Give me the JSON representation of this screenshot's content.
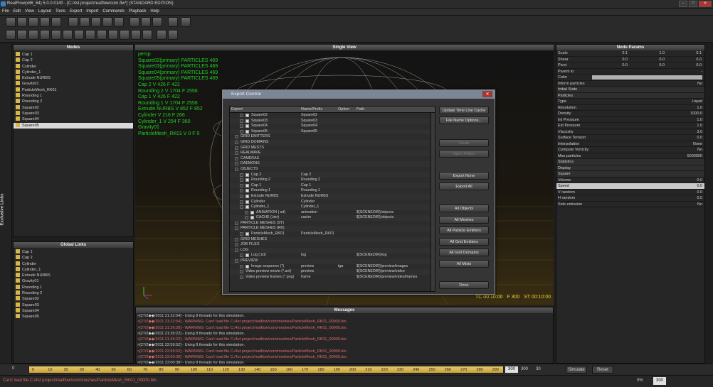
{
  "window": {
    "title": "RealFlow(x86_64) 5.0.0.0140 - [C:/4st project/realflow/com.flw*] (STANDARD EDITION)"
  },
  "menu": [
    "File",
    "Edit",
    "View",
    "Layout",
    "Tools",
    "Export",
    "Import",
    "Commands",
    "Playback",
    "Help"
  ],
  "nodes_panel": {
    "title": "Nodes",
    "items": [
      "Cap 1",
      "Cap 2",
      "Cylinder",
      "Cylinder_1",
      "Extrude NURBS",
      "Gravity01",
      "ParticleMesh_RK01",
      "Rounding 1",
      "Rounding 2",
      "Square02",
      "Square03",
      "Square04",
      "Square05"
    ],
    "selected": "Square05"
  },
  "exclusive_links": {
    "label": "Exclusive Links"
  },
  "global_links": {
    "title": "Global Links",
    "items": [
      "Cap 1",
      "Cap 2",
      "Cylinder",
      "Cylinder_1",
      "Extrude NURBS",
      "Gravity01",
      "Rounding 1",
      "Rounding 2",
      "Square02",
      "Square03",
      "Square04",
      "Square05"
    ]
  },
  "viewport": {
    "title": "Single View",
    "lines": [
      "persp",
      "Square02(primary) PARTICLES 469",
      "Square03(primary) PARTICLES 469",
      "Square04(primary) PARTICLES 469",
      "Square05(primary) PARTICLES 469",
      "Cap 2 V 426 F 422",
      "Rounding 2 V 1704 F 2556",
      "Cap 1 V 426 F 422",
      "Rounding 1 V 1704 F 2556",
      "Extrude NURBS V 852 F 852",
      "Cylinder V 216 F 266",
      "Cylinder_1 V 254 F 360",
      "Gravity01",
      "ParticleMesh_RK01 V 0 F 0"
    ],
    "tc": "TC 00:10:00",
    "frame": "F 300",
    "st": "ST 00:10:00"
  },
  "export_dialog": {
    "title": "Export Central",
    "columns": [
      "Export",
      "Name/Prefix",
      "Option",
      "Path"
    ],
    "rows": [
      {
        "indent": 2,
        "cb": true,
        "label": "Square02",
        "name": "Square02",
        "option": "",
        "path": ""
      },
      {
        "indent": 2,
        "cb": true,
        "label": "Square03",
        "name": "Square03",
        "option": "",
        "path": ""
      },
      {
        "indent": 2,
        "cb": true,
        "label": "Square04",
        "name": "Square04",
        "option": "",
        "path": ""
      },
      {
        "indent": 2,
        "cb": true,
        "label": "Square05",
        "name": "Square05",
        "option": "",
        "path": ""
      },
      {
        "indent": 1,
        "cb": false,
        "label": "GRID EMITTERS",
        "name": "",
        "option": "",
        "path": ""
      },
      {
        "indent": 1,
        "cb": false,
        "label": "GRID DOMAINS",
        "name": "",
        "option": "",
        "path": ""
      },
      {
        "indent": 1,
        "cb": false,
        "label": "GRID MESTS",
        "name": "",
        "option": "",
        "path": ""
      },
      {
        "indent": 1,
        "cb": false,
        "label": "REALWAVE",
        "name": "",
        "option": "",
        "path": ""
      },
      {
        "indent": 1,
        "cb": false,
        "label": "CAMERAS",
        "name": "",
        "option": "",
        "path": ""
      },
      {
        "indent": 1,
        "cb": false,
        "label": "DAEMONS",
        "name": "",
        "option": "",
        "path": ""
      },
      {
        "indent": 1,
        "cb": false,
        "label": "OBJECTS",
        "name": "",
        "option": "",
        "path": ""
      },
      {
        "indent": 2,
        "cb": true,
        "label": "Cap 2",
        "name": "Cap 2",
        "option": "",
        "path": ""
      },
      {
        "indent": 2,
        "cb": true,
        "label": "Rounding 2",
        "name": "Rounding 2",
        "option": "",
        "path": ""
      },
      {
        "indent": 2,
        "cb": true,
        "label": "Cap 1",
        "name": "Cap 1",
        "option": "",
        "path": ""
      },
      {
        "indent": 2,
        "cb": true,
        "label": "Rounding 1",
        "name": "Rounding 1",
        "option": "",
        "path": ""
      },
      {
        "indent": 2,
        "cb": true,
        "label": "Extrude NURBS",
        "name": "Extrude NURBS",
        "option": "",
        "path": ""
      },
      {
        "indent": 2,
        "cb": true,
        "label": "Cylinder",
        "name": "Cylinder",
        "option": "",
        "path": ""
      },
      {
        "indent": 2,
        "cb": true,
        "label": "Cylinder_1",
        "name": "Cylinder_1",
        "option": "",
        "path": ""
      },
      {
        "indent": 3,
        "cb": true,
        "label": "ANIMATION (.sd)",
        "name": "animation",
        "option": "",
        "path": "${SCENEDIR}/objects"
      },
      {
        "indent": 3,
        "cb": true,
        "label": "CACHE (.bin)",
        "name": "cache",
        "option": "",
        "path": "${SCENEDIR}/objects"
      },
      {
        "indent": 1,
        "cb": false,
        "label": "PARTICLE MESHES (ST)",
        "name": "",
        "option": "",
        "path": ""
      },
      {
        "indent": 1,
        "cb": false,
        "label": "PARTICLE MESHES (RK)",
        "name": "",
        "option": "",
        "path": ""
      },
      {
        "indent": 2,
        "cb": true,
        "label": "ParticleMesh_RK01",
        "name": "ParticleMesh_RK01",
        "option": "",
        "path": ""
      },
      {
        "indent": 1,
        "cb": false,
        "label": "GRID MESHES",
        "name": "",
        "option": "",
        "path": ""
      },
      {
        "indent": 1,
        "cb": false,
        "label": "JOB FILES",
        "name": "",
        "option": "",
        "path": ""
      },
      {
        "indent": 1,
        "cb": false,
        "label": "LOG",
        "name": "",
        "option": "",
        "path": ""
      },
      {
        "indent": 2,
        "cb": true,
        "label": "Log (.txt)",
        "name": "log",
        "option": "",
        "path": "${SCENEDIR}/log"
      },
      {
        "indent": 1,
        "cb": false,
        "label": "PREVIEW",
        "name": "",
        "option": "",
        "path": ""
      },
      {
        "indent": 2,
        "cb": true,
        "label": "Image sequence (*)",
        "name": "preview",
        "option": "tga",
        "path": "${SCENEDIR}/preview/images"
      },
      {
        "indent": 2,
        "cb": false,
        "label": "Video preview movie (*.avi)",
        "name": "preview",
        "option": "",
        "path": "${SCENEDIR}/preview/video"
      },
      {
        "indent": 2,
        "cb": false,
        "label": "Video preview frames (*.png)",
        "name": "frame",
        "option": "",
        "path": "${SCENEDIR}/preview/video/frames"
      }
    ],
    "buttons": [
      "Update Time Line Cache",
      "File Name Options...",
      "Clean",
      "Open Folder",
      "Export None",
      "Export All",
      "All Objects",
      "All Meshes",
      "All Particle Emitters",
      "All Grid Emitters",
      "All Grid Domains",
      "All Mists",
      "Done"
    ]
  },
  "node_params": {
    "title": "Node Params",
    "rows": [
      {
        "k": "Scale",
        "v": [
          "0.1",
          "1.0",
          "0.1"
        ]
      },
      {
        "k": "Shear",
        "v": [
          "0.0",
          "0.0",
          "0.0"
        ]
      },
      {
        "k": "Pivot",
        "v": [
          "0.0",
          "0.0",
          "0.0"
        ]
      },
      {
        "k": "Parent to",
        "v": [
          "-"
        ]
      },
      {
        "k": "Color",
        "v": [
          ""
        ]
      },
      {
        "k": "Inform particles",
        "v": [
          "No"
        ]
      }
    ],
    "sec1": "Initial State",
    "sec2": "Particles",
    "particles": [
      {
        "k": "Type",
        "v": "Liquid"
      },
      {
        "k": "Resolution",
        "v": "1.0"
      },
      {
        "k": "Density",
        "v": "1000.0"
      },
      {
        "k": "Int Pressure",
        "v": "1.0"
      },
      {
        "k": "Ext Pressure",
        "v": "1.0"
      },
      {
        "k": "Viscosity",
        "v": "3.0"
      },
      {
        "k": "Surface Tension",
        "v": "0.0"
      },
      {
        "k": "Interpolation",
        "v": "None"
      },
      {
        "k": "Compute Vorticity",
        "v": "No"
      },
      {
        "k": "Max particles",
        "v": "5000000"
      }
    ],
    "sec3": "Statistics",
    "sec4": "Display",
    "sec5": "Square",
    "square": [
      {
        "k": "Volume",
        "v": "0.0"
      },
      {
        "k": "Speed",
        "v": "0.0",
        "sel": true
      },
      {
        "k": "V random",
        "v": "0.0"
      },
      {
        "k": "H random",
        "v": "0.0"
      },
      {
        "k": "Side emission",
        "v": "No"
      }
    ]
  },
  "messages": {
    "title": "Messages",
    "lines": [
      {
        "t": ">[27/2◆◆/2011 21:22:54] - Using 8 threads for this simulation.",
        "w": false
      },
      {
        "t": ">[27/2◆◆/2011 21:22:54] - WARNING: Can't load file C:/4st project/realflow/com/meshes/ParticleMesh_RK01_00000.bin.",
        "w": true
      },
      {
        "t": ">[27/2◆◆/2011 21:26:30] - WARNING: Can't load file C:/4st project/realflow/com/meshes/ParticleMesh_RK01_00000.bin.",
        "w": true
      },
      {
        "t": ">[27/2◆◆/2011 21:26:22] - Using 8 threads for this simulation.",
        "w": false
      },
      {
        "t": ">[27/2◆◆/2011 21:26:22] - WARNING: Can't load file C:/4st project/realflow/com/meshes/ParticleMesh_RK01_00000.bin.",
        "w": true
      },
      {
        "t": ">[27/2◆◆/2011 22:59:52] - Using 8 threads for this simulation.",
        "w": false
      },
      {
        "t": ">[27/2◆◆/2011 22:59:52] - WARNING: Can't load file C:/4st project/realflow/com/meshes/ParticleMesh_RK01_00000.bin.",
        "w": true
      },
      {
        "t": ">[27/2◆◆/2011 23:00:30] - WARNING: Can't load file C:/4st project/realflow/com/meshes/ParticleMesh_RK01_00000.bin.",
        "w": true
      },
      {
        "t": ">[27/2◆◆/2011 23:00:38] - Using 8 threads for this simulation.",
        "w": false
      },
      {
        "t": ">[27/2◆◆/2011 23:00:38] - WARNING: Can't load file C:/4st project/realflow/com/meshes/ParticleMesh_RK01_00000.bin.",
        "w": true
      }
    ]
  },
  "timeline": {
    "start": "0",
    "ticks": [
      "0",
      "10",
      "20",
      "30",
      "40",
      "50",
      "60",
      "70",
      "80",
      "90",
      "100",
      "110",
      "120",
      "130",
      "140",
      "150",
      "160",
      "170",
      "180",
      "190",
      "200",
      "210",
      "220",
      "230",
      "240",
      "250",
      "260",
      "270",
      "280",
      "290"
    ],
    "end_field": "300",
    "end2": "300",
    "end3": "30"
  },
  "transport": {
    "simulate": "Simulate",
    "reset": "Reset",
    "zoom": "0%",
    "frame": "300"
  },
  "status": {
    "text": "Can't load file C:/4st project/realflow/com/meshes/ParticleMesh_RK01_00000.bin."
  }
}
